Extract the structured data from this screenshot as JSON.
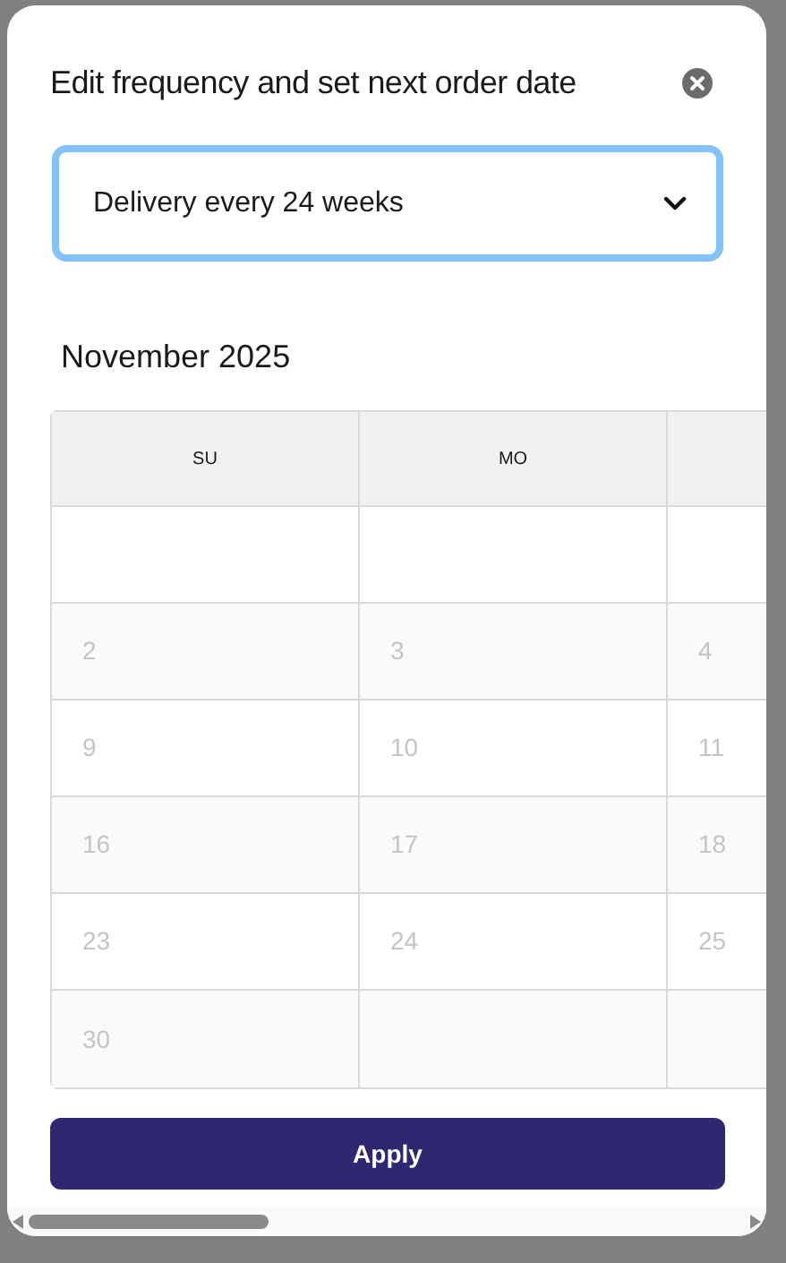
{
  "dialog": {
    "title": "Edit frequency and set next order date"
  },
  "frequency_select": {
    "value": "Delivery every 24 weeks",
    "focused": true
  },
  "calendar": {
    "month": "November 2025",
    "columns": [
      "SU",
      "MO"
    ],
    "weeks": [
      [
        {
          "kind": "empty"
        },
        {
          "kind": "empty"
        },
        {
          "kind": "empty"
        }
      ],
      [
        {
          "kind": "day",
          "day": "2",
          "disabled": true
        },
        {
          "kind": "day",
          "day": "3",
          "disabled": true
        },
        {
          "kind": "day",
          "day": "4",
          "disabled": true
        }
      ],
      [
        {
          "kind": "day",
          "day": "9",
          "disabled": true
        },
        {
          "kind": "day",
          "day": "10",
          "disabled": true
        },
        {
          "kind": "day",
          "day": "11",
          "disabled": true
        }
      ],
      [
        {
          "kind": "day",
          "day": "16",
          "disabled": true
        },
        {
          "kind": "day",
          "day": "17",
          "disabled": true
        },
        {
          "kind": "day",
          "day": "18",
          "disabled": true
        }
      ],
      [
        {
          "kind": "day",
          "day": "23",
          "disabled": true
        },
        {
          "kind": "day",
          "day": "24",
          "disabled": true
        },
        {
          "kind": "day",
          "day": "25",
          "disabled": true
        }
      ],
      [
        {
          "kind": "day",
          "day": "30",
          "disabled": true
        },
        {
          "kind": "empty"
        },
        {
          "kind": "empty"
        }
      ]
    ]
  },
  "apply_button": {
    "label": "Apply"
  }
}
